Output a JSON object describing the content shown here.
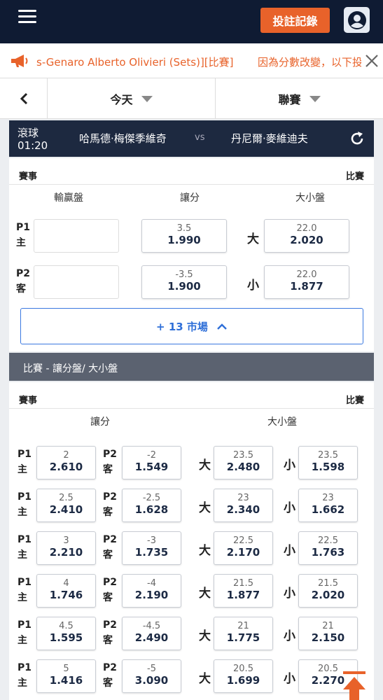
{
  "header": {
    "bet_record_label": "投註記錄",
    "accent": "#e8622a",
    "bg": "#0f1b33"
  },
  "marquee": {
    "left_text": "s-Genaro Alberto Olivieri (Sets)][比賽]",
    "right_text": "因為分數改變，以下投"
  },
  "filters": {
    "date": "今天",
    "league": "聯賽"
  },
  "match": {
    "status": "滾球",
    "time": "01:20",
    "home": "哈馬德·梅傑季維奇",
    "vs": "vs",
    "away": "丹尼爾·麥維迪夫"
  },
  "main_market": {
    "head_left": "賽事",
    "head_right": "比賽",
    "col_moneyline": "輸贏盤",
    "col_handicap": "讓分",
    "col_total": "大小盤",
    "row1": {
      "p": "P1",
      "side": "主",
      "hcp_line": "3.5",
      "hcp_price": "1.990",
      "total_label": "大",
      "total_line": "22.0",
      "total_price": "2.020"
    },
    "row2": {
      "p": "P2",
      "side": "客",
      "hcp_line": "-3.5",
      "hcp_price": "1.900",
      "total_label": "小",
      "total_line": "22.0",
      "total_price": "1.877"
    },
    "more_label": "+ 13 市場"
  },
  "alt_section": {
    "banner": "比賽 - 讓分盤/ 大小盤",
    "head_left": "賽事",
    "head_right": "比賽",
    "col_handicap": "讓分",
    "col_total": "大小盤",
    "rows": [
      {
        "p1": "P1",
        "s1": "主",
        "h1_line": "2",
        "h1_price": "2.610",
        "p2": "P2",
        "s2": "客",
        "h2_line": "-2",
        "h2_price": "1.549",
        "o_label": "大",
        "o_line": "23.5",
        "o_price": "2.480",
        "u_label": "小",
        "u_line": "23.5",
        "u_price": "1.598"
      },
      {
        "p1": "P1",
        "s1": "主",
        "h1_line": "2.5",
        "h1_price": "2.410",
        "p2": "P2",
        "s2": "客",
        "h2_line": "-2.5",
        "h2_price": "1.628",
        "o_label": "大",
        "o_line": "23",
        "o_price": "2.340",
        "u_label": "小",
        "u_line": "23",
        "u_price": "1.662"
      },
      {
        "p1": "P1",
        "s1": "主",
        "h1_line": "3",
        "h1_price": "2.210",
        "p2": "P2",
        "s2": "客",
        "h2_line": "-3",
        "h2_price": "1.735",
        "o_label": "大",
        "o_line": "22.5",
        "o_price": "2.170",
        "u_label": "小",
        "u_line": "22.5",
        "u_price": "1.763"
      },
      {
        "p1": "P1",
        "s1": "主",
        "h1_line": "4",
        "h1_price": "1.746",
        "p2": "P2",
        "s2": "客",
        "h2_line": "-4",
        "h2_price": "2.190",
        "o_label": "大",
        "o_line": "21.5",
        "o_price": "1.877",
        "u_label": "小",
        "u_line": "21.5",
        "u_price": "2.020"
      },
      {
        "p1": "P1",
        "s1": "主",
        "h1_line": "4.5",
        "h1_price": "1.595",
        "p2": "P2",
        "s2": "客",
        "h2_line": "-4.5",
        "h2_price": "2.490",
        "o_label": "大",
        "o_line": "21",
        "o_price": "1.775",
        "u_label": "小",
        "u_line": "21",
        "u_price": "2.150"
      },
      {
        "p1": "P1",
        "s1": "主",
        "h1_line": "5",
        "h1_price": "1.416",
        "p2": "P2",
        "s2": "客",
        "h2_line": "-5",
        "h2_price": "3.090",
        "o_label": "大",
        "o_line": "20.5",
        "o_price": "1.699",
        "u_label": "小",
        "u_line": "20.5",
        "u_price": "2.270"
      }
    ]
  }
}
